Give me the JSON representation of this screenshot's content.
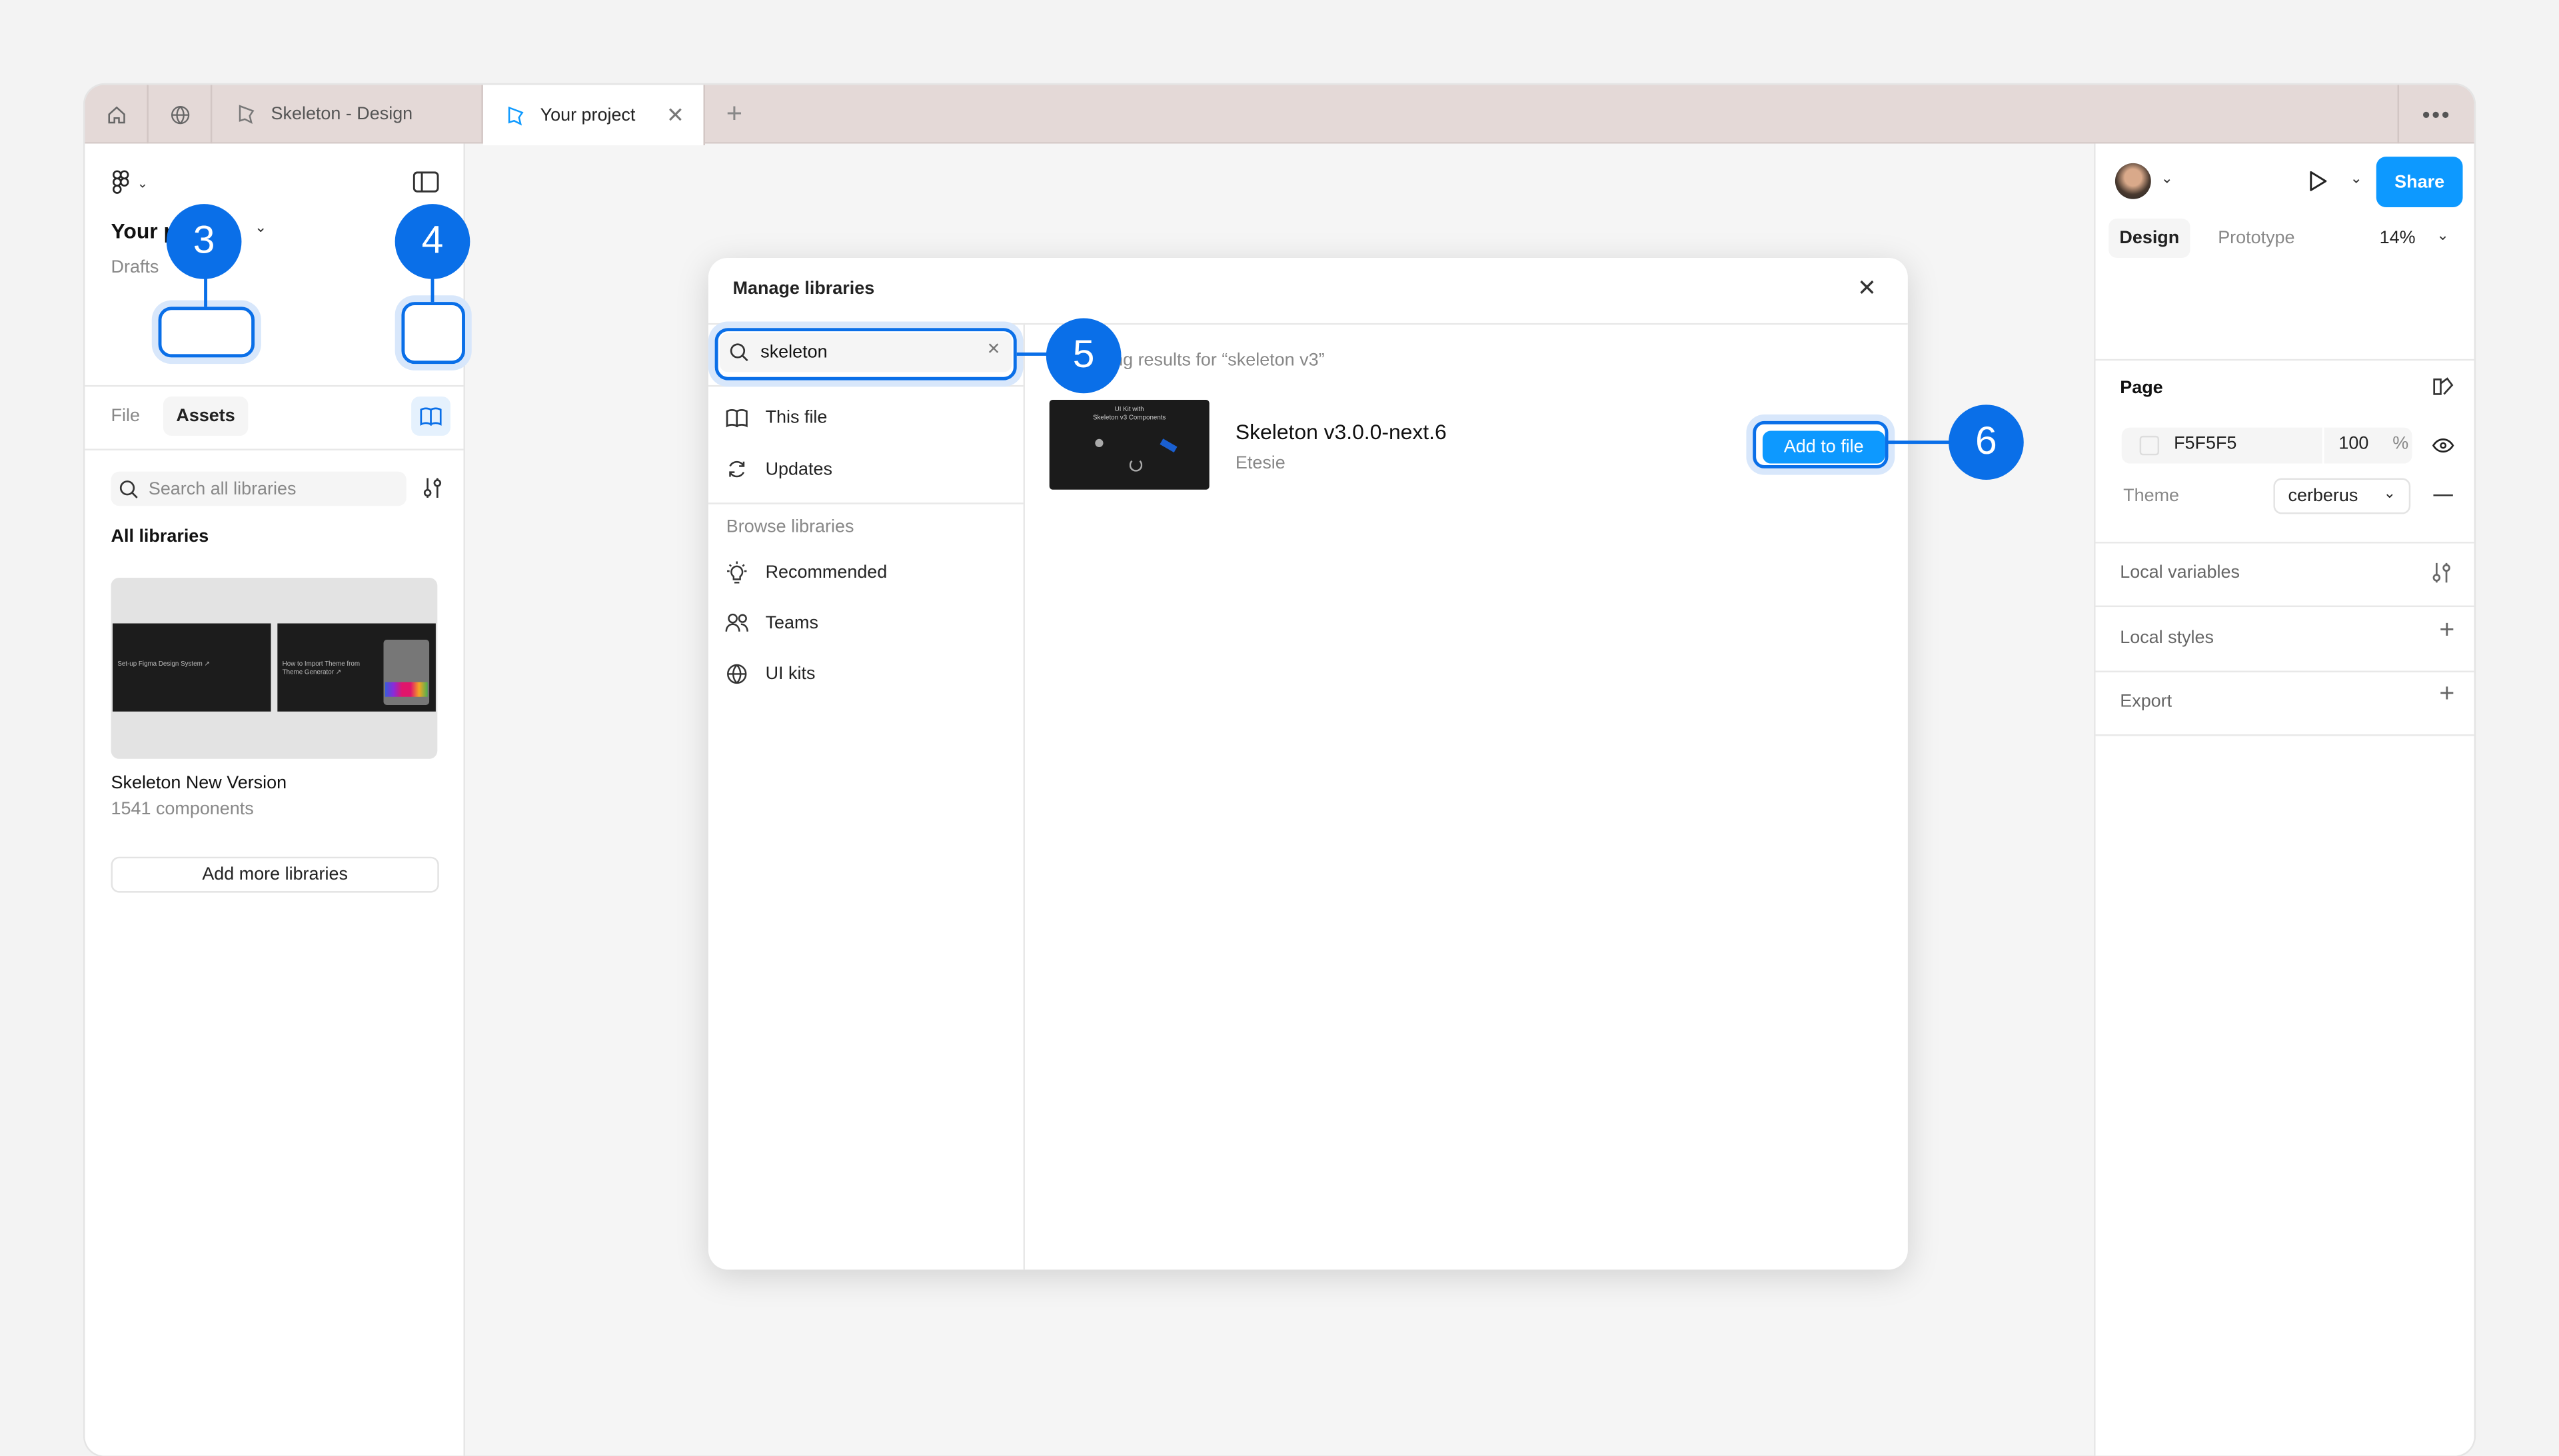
{
  "tabs": [
    {
      "icon": "home-icon"
    },
    {
      "icon": "globe-icon"
    },
    {
      "label": "Skeleton - Design",
      "icon": "pen-file-icon"
    },
    {
      "label": "Your project",
      "icon": "pen-file-icon",
      "active": true
    }
  ],
  "left_panel": {
    "project_name": "Your project",
    "location": "Drafts",
    "tab_file": "File",
    "tab_assets": "Assets",
    "search_placeholder": "Search all libraries",
    "all_libraries": "All libraries",
    "library": {
      "name": "Skeleton New Version",
      "count": "1541 components",
      "thumb_text_1": "Set-up Figma Design System ↗",
      "thumb_text_2": "How to Import Theme from Theme Generator ↗"
    },
    "add_more": "Add more libraries"
  },
  "modal": {
    "title": "Manage libraries",
    "search_value": "skeleton",
    "nav": [
      {
        "label": "This file",
        "icon": "book-icon"
      },
      {
        "label": "Updates",
        "icon": "refresh-icon"
      }
    ],
    "browse_heading": "Browse libraries",
    "browse": [
      {
        "label": "Recommended",
        "icon": "lightbulb-icon"
      },
      {
        "label": "Teams",
        "icon": "people-icon"
      },
      {
        "label": "UI kits",
        "icon": "globe-icon"
      }
    ],
    "results_text": "Showing results for “skeleton v3”",
    "result": {
      "name": "Skeleton v3.0.0-next.6",
      "author": "Etesie",
      "thumb_line1": "UI Kit with",
      "thumb_line2": "Skeleton v3 Components",
      "action": "Add to file"
    }
  },
  "right_panel": {
    "share": "Share",
    "tab_design": "Design",
    "tab_prototype": "Prototype",
    "zoom": "14%",
    "page_heading": "Page",
    "bg_color": "F5F5F5",
    "bg_opacity": "100",
    "percent": "%",
    "theme_label": "Theme",
    "theme_value": "cerberus",
    "local_variables": "Local variables",
    "local_styles": "Local styles",
    "export": "Export"
  },
  "annotations": [
    "3",
    "4",
    "5",
    "6"
  ],
  "colors": {
    "accent": "#0a6fe8",
    "share": "#0d99ff",
    "tabbar": "#e4d9d7"
  }
}
